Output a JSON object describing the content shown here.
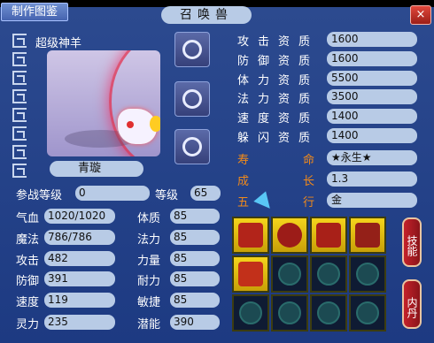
{
  "window": {
    "title": "召唤兽",
    "make_button": "制作图鉴",
    "close_icon": "×"
  },
  "pet": {
    "species": "超级神羊",
    "nickname": "青璇"
  },
  "left_stats": {
    "battle_level_label": "参战等级",
    "battle_level_value": "0",
    "level_label": "等级",
    "level_value": "65",
    "hp_label": "气血",
    "hp_value": "1020/1020",
    "mp_label": "魔法",
    "mp_value": "786/786",
    "atk_label": "攻击",
    "atk_value": "482",
    "def_label": "防御",
    "def_value": "391",
    "spd_label": "速度",
    "spd_value": "119",
    "spirit_label": "灵力",
    "spirit_value": "235",
    "con_label": "体质",
    "con_value": "85",
    "mag_label": "法力",
    "mag_value": "85",
    "str_label": "力量",
    "str_value": "85",
    "end_label": "耐力",
    "end_value": "85",
    "agi_label": "敏捷",
    "agi_value": "85",
    "potential_label": "潜能",
    "potential_value": "390"
  },
  "aptitude": [
    {
      "label": "攻击资质",
      "value": "1600"
    },
    {
      "label": "防御资质",
      "value": "1600"
    },
    {
      "label": "体力资质",
      "value": "5500"
    },
    {
      "label": "法力资质",
      "value": "3500"
    },
    {
      "label": "速度资质",
      "value": "1400"
    },
    {
      "label": "躲闪资质",
      "value": "1400"
    }
  ],
  "traits": {
    "life_label_a": "寿",
    "life_label_b": "命",
    "life_value": "★永生★",
    "growth_label_a": "成",
    "growth_label_b": "长",
    "growth_value": "1.3",
    "element_label_a": "五",
    "element_label_b": "行",
    "element_value": "金"
  },
  "tabs": {
    "skills": "技能",
    "core": "内丹"
  },
  "colors": {
    "panel": "#2c4a8f",
    "field": "#b8cbe6",
    "trait_label": "#f28a1a",
    "skill_gold": "#f4d41c"
  }
}
